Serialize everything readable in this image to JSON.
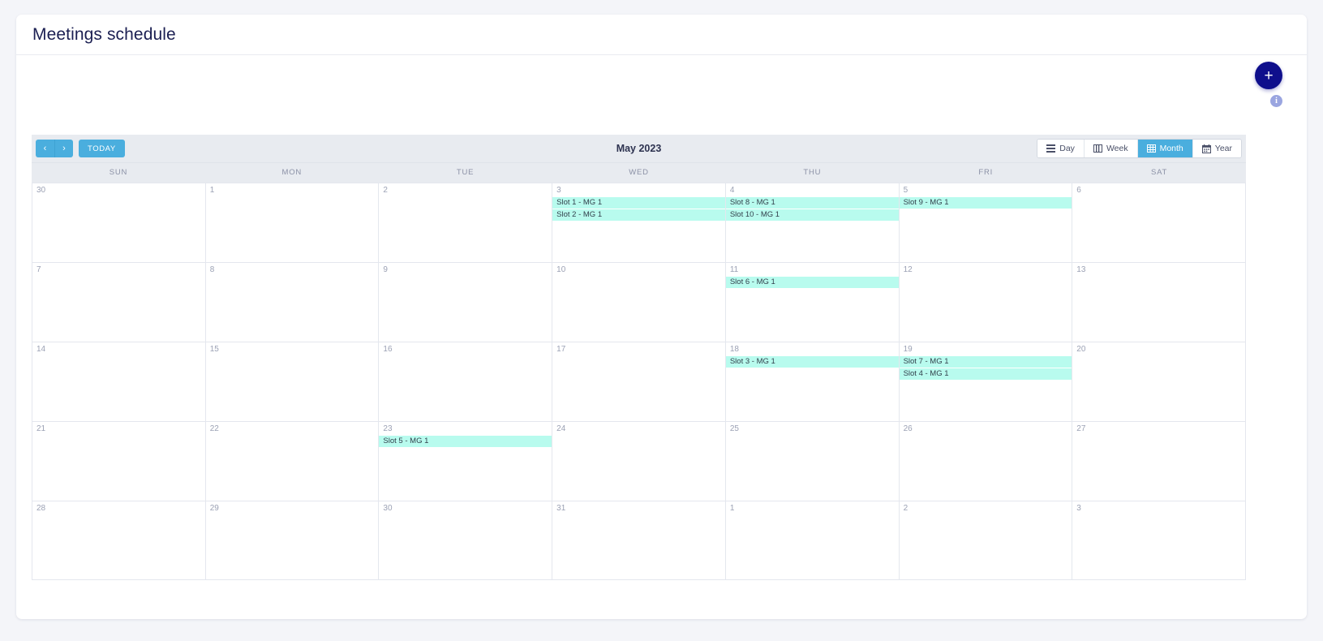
{
  "header": {
    "title": "Meetings schedule"
  },
  "actions": {
    "add_label": "+",
    "add_name": "plus-icon",
    "info_label": "i",
    "accent_navy": "#0f0f8c",
    "info_color": "#9aa5e0"
  },
  "toolbar": {
    "prev_label": "‹",
    "next_label": "›",
    "today_label": "TODAY",
    "month_title": "May 2023",
    "accent_blue": "#4aaede",
    "views": [
      {
        "label": "Day",
        "icon": "list-icon",
        "active": false
      },
      {
        "label": "Week",
        "icon": "columns-icon",
        "active": false
      },
      {
        "label": "Month",
        "icon": "grid-icon",
        "active": true
      },
      {
        "label": "Year",
        "icon": "calendar-icon",
        "active": false
      }
    ]
  },
  "calendar": {
    "weekdays": [
      "SUN",
      "MON",
      "TUE",
      "WED",
      "THU",
      "FRI",
      "SAT"
    ],
    "event_color": "#b8fbee",
    "weeks": [
      [
        {
          "day": "30",
          "events": []
        },
        {
          "day": "1",
          "events": []
        },
        {
          "day": "2",
          "events": []
        },
        {
          "day": "3",
          "events": [
            "Slot 1 - MG 1",
            "Slot 2 - MG 1"
          ]
        },
        {
          "day": "4",
          "events": [
            "Slot 8 - MG 1",
            "Slot 10 - MG 1"
          ]
        },
        {
          "day": "5",
          "events": [
            "Slot 9 - MG 1"
          ]
        },
        {
          "day": "6",
          "events": []
        }
      ],
      [
        {
          "day": "7",
          "events": []
        },
        {
          "day": "8",
          "events": []
        },
        {
          "day": "9",
          "events": []
        },
        {
          "day": "10",
          "events": []
        },
        {
          "day": "11",
          "events": [
            "Slot 6 - MG 1"
          ]
        },
        {
          "day": "12",
          "events": []
        },
        {
          "day": "13",
          "events": []
        }
      ],
      [
        {
          "day": "14",
          "events": []
        },
        {
          "day": "15",
          "events": []
        },
        {
          "day": "16",
          "events": []
        },
        {
          "day": "17",
          "events": []
        },
        {
          "day": "18",
          "events": [
            "Slot 3 - MG 1"
          ]
        },
        {
          "day": "19",
          "events": [
            "Slot 7 - MG 1",
            "Slot 4 - MG 1"
          ]
        },
        {
          "day": "20",
          "events": []
        }
      ],
      [
        {
          "day": "21",
          "events": []
        },
        {
          "day": "22",
          "events": []
        },
        {
          "day": "23",
          "events": [
            "Slot 5 - MG 1"
          ]
        },
        {
          "day": "24",
          "events": []
        },
        {
          "day": "25",
          "events": []
        },
        {
          "day": "26",
          "events": []
        },
        {
          "day": "27",
          "events": []
        }
      ],
      [
        {
          "day": "28",
          "events": []
        },
        {
          "day": "29",
          "events": []
        },
        {
          "day": "30",
          "events": []
        },
        {
          "day": "31",
          "events": []
        },
        {
          "day": "1",
          "events": []
        },
        {
          "day": "2",
          "events": []
        },
        {
          "day": "3",
          "events": []
        }
      ]
    ]
  }
}
